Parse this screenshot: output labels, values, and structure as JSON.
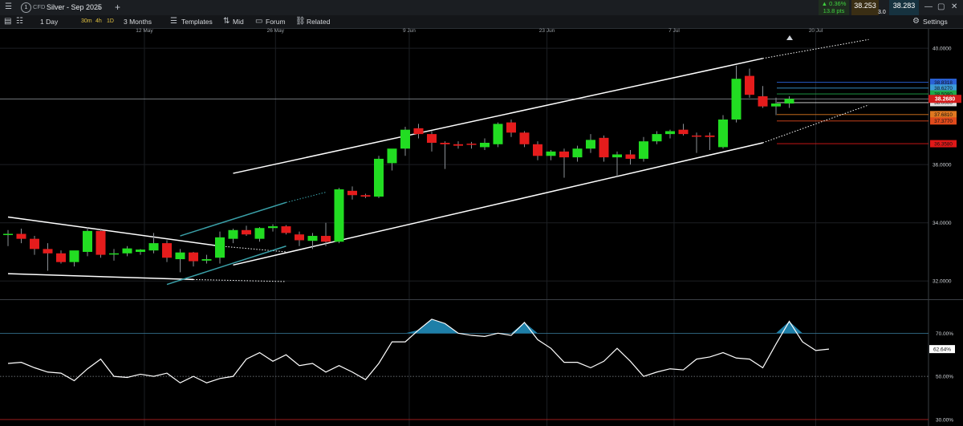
{
  "header": {
    "instrument_label": "CFD",
    "title": "Silver - Sep 2025",
    "add_label": "+",
    "change_pct": "▲ 0.36%",
    "change_pts": "13.8 pts",
    "bid": "38.253",
    "spread": "3.0",
    "ask": "38.283"
  },
  "toolbar": {
    "interval": "1 Day",
    "intervals": [
      "30m",
      "4h",
      "1D"
    ],
    "range": "3 Months",
    "templates": "Templates",
    "mid": "Mid",
    "forum": "Forum",
    "related": "Related",
    "settings": "Settings"
  },
  "colors": {
    "up": "#22dd22",
    "down": "#e51c1c",
    "rsi_line": "#ffffff",
    "rsi_fill": "#1e7fa8",
    "channel": "#ffffff",
    "teal_channel": "#3aa0a8"
  },
  "chart_data": [
    {
      "type": "candlestick",
      "title": "",
      "x_tick_labels": [
        "12 May",
        "26 May",
        "9 Jun",
        "23 Jun",
        "7 Jul",
        "20 Jul"
      ],
      "y_tick_labels": [
        "40.0000",
        "36.0000",
        "34.0000",
        "32.0000"
      ],
      "ylim": [
        31.4,
        40.5
      ],
      "grid": true,
      "current_price": "38.2680",
      "price_tags": [
        {
          "label": "38.8318",
          "value": 38.83,
          "color": "#2a62d6"
        },
        {
          "label": "38.6270",
          "value": 38.63,
          "color": "#3c9bd6"
        },
        {
          "label": "38.5080",
          "value": 38.43,
          "color": "#1fa84a"
        },
        {
          "label": "38.0000",
          "value": 38.13,
          "color": "#e0e0e0"
        },
        {
          "label": "37.6810",
          "value": 37.72,
          "color": "#e07820"
        },
        {
          "label": "37.3770",
          "value": 37.5,
          "color": "#e04a1c"
        },
        {
          "label": "36.3580",
          "value": 36.72,
          "color": "#e01818"
        }
      ],
      "candles": [
        {
          "o": 33.58,
          "h": 33.75,
          "l": 33.2,
          "c": 33.62
        },
        {
          "o": 33.62,
          "h": 33.8,
          "l": 33.3,
          "c": 33.45
        },
        {
          "o": 33.45,
          "h": 33.55,
          "l": 32.9,
          "c": 33.1
        },
        {
          "o": 33.1,
          "h": 33.3,
          "l": 32.35,
          "c": 32.95
        },
        {
          "o": 32.95,
          "h": 33.05,
          "l": 32.6,
          "c": 32.65
        },
        {
          "o": 32.65,
          "h": 33.0,
          "l": 32.5,
          "c": 33.05
        },
        {
          "o": 33.0,
          "h": 33.85,
          "l": 32.85,
          "c": 33.72
        },
        {
          "o": 33.72,
          "h": 33.8,
          "l": 32.8,
          "c": 32.9
        },
        {
          "o": 32.92,
          "h": 33.1,
          "l": 32.7,
          "c": 32.95
        },
        {
          "o": 32.95,
          "h": 33.2,
          "l": 32.85,
          "c": 33.12
        },
        {
          "o": 33.0,
          "h": 33.1,
          "l": 32.9,
          "c": 33.08
        },
        {
          "o": 33.05,
          "h": 33.65,
          "l": 32.95,
          "c": 33.3
        },
        {
          "o": 33.3,
          "h": 33.4,
          "l": 32.65,
          "c": 32.8
        },
        {
          "o": 32.75,
          "h": 33.1,
          "l": 32.3,
          "c": 32.98
        },
        {
          "o": 32.98,
          "h": 33.0,
          "l": 32.5,
          "c": 32.68
        },
        {
          "o": 32.7,
          "h": 32.9,
          "l": 32.6,
          "c": 32.75
        },
        {
          "o": 32.8,
          "h": 33.7,
          "l": 32.6,
          "c": 33.5
        },
        {
          "o": 33.45,
          "h": 33.8,
          "l": 33.3,
          "c": 33.75
        },
        {
          "o": 33.75,
          "h": 33.9,
          "l": 33.55,
          "c": 33.6
        },
        {
          "o": 33.45,
          "h": 33.85,
          "l": 33.35,
          "c": 33.82
        },
        {
          "o": 33.82,
          "h": 33.95,
          "l": 33.7,
          "c": 33.88
        },
        {
          "o": 33.88,
          "h": 33.92,
          "l": 33.6,
          "c": 33.65
        },
        {
          "o": 33.6,
          "h": 33.7,
          "l": 33.2,
          "c": 33.4
        },
        {
          "o": 33.38,
          "h": 33.65,
          "l": 33.1,
          "c": 33.55
        },
        {
          "o": 33.55,
          "h": 34.0,
          "l": 33.2,
          "c": 33.35
        },
        {
          "o": 33.35,
          "h": 35.2,
          "l": 33.3,
          "c": 35.15
        },
        {
          "o": 35.1,
          "h": 35.25,
          "l": 34.8,
          "c": 34.95
        },
        {
          "o": 34.95,
          "h": 35.0,
          "l": 34.85,
          "c": 34.9
        },
        {
          "o": 34.9,
          "h": 36.3,
          "l": 34.85,
          "c": 36.2
        },
        {
          "o": 36.05,
          "h": 36.5,
          "l": 35.8,
          "c": 36.55
        },
        {
          "o": 36.55,
          "h": 37.3,
          "l": 36.3,
          "c": 37.2
        },
        {
          "o": 37.25,
          "h": 37.4,
          "l": 36.9,
          "c": 37.05
        },
        {
          "o": 37.05,
          "h": 37.15,
          "l": 36.45,
          "c": 36.75
        },
        {
          "o": 36.75,
          "h": 36.8,
          "l": 35.85,
          "c": 36.7
        },
        {
          "o": 36.7,
          "h": 36.8,
          "l": 36.55,
          "c": 36.65
        },
        {
          "o": 36.72,
          "h": 36.78,
          "l": 36.55,
          "c": 36.68
        },
        {
          "o": 36.6,
          "h": 36.9,
          "l": 36.5,
          "c": 36.75
        },
        {
          "o": 36.7,
          "h": 37.45,
          "l": 36.6,
          "c": 37.4
        },
        {
          "o": 37.45,
          "h": 37.55,
          "l": 36.95,
          "c": 37.1
        },
        {
          "o": 37.1,
          "h": 37.15,
          "l": 36.6,
          "c": 36.7
        },
        {
          "o": 36.7,
          "h": 36.8,
          "l": 36.15,
          "c": 36.3
        },
        {
          "o": 36.3,
          "h": 36.5,
          "l": 36.15,
          "c": 36.45
        },
        {
          "o": 36.45,
          "h": 36.55,
          "l": 35.55,
          "c": 36.25
        },
        {
          "o": 36.25,
          "h": 36.65,
          "l": 36.1,
          "c": 36.55
        },
        {
          "o": 36.55,
          "h": 37.05,
          "l": 36.4,
          "c": 36.85
        },
        {
          "o": 36.92,
          "h": 37.0,
          "l": 36.1,
          "c": 36.25
        },
        {
          "o": 36.25,
          "h": 36.45,
          "l": 35.6,
          "c": 36.35
        },
        {
          "o": 36.35,
          "h": 36.5,
          "l": 36.0,
          "c": 36.2
        },
        {
          "o": 36.2,
          "h": 36.95,
          "l": 36.1,
          "c": 36.8
        },
        {
          "o": 36.8,
          "h": 37.15,
          "l": 36.7,
          "c": 37.05
        },
        {
          "o": 37.05,
          "h": 37.2,
          "l": 36.9,
          "c": 37.15
        },
        {
          "o": 37.2,
          "h": 37.4,
          "l": 37.0,
          "c": 37.05
        },
        {
          "o": 37.0,
          "h": 37.1,
          "l": 36.4,
          "c": 36.98
        },
        {
          "o": 37.0,
          "h": 37.1,
          "l": 36.5,
          "c": 36.95
        },
        {
          "o": 36.6,
          "h": 37.7,
          "l": 36.55,
          "c": 37.55
        },
        {
          "o": 37.55,
          "h": 39.4,
          "l": 37.45,
          "c": 38.95
        },
        {
          "o": 39.05,
          "h": 39.3,
          "l": 38.3,
          "c": 38.4
        },
        {
          "o": 38.35,
          "h": 38.7,
          "l": 37.95,
          "c": 38.0
        },
        {
          "o": 38.0,
          "h": 38.3,
          "l": 37.7,
          "c": 38.1
        },
        {
          "o": 38.1,
          "h": 38.35,
          "l": 37.95,
          "c": 38.26
        }
      ],
      "trendlines": [
        {
          "name": "upper-channel",
          "color": "#ffffff",
          "dotted": false,
          "points": [
            [
              17,
              35.7
            ],
            [
              57,
              39.65
            ]
          ]
        },
        {
          "name": "upper-channel-ext",
          "color": "#ffffff",
          "dotted": true,
          "points": [
            [
              57,
              39.65
            ],
            [
              65,
              40.3
            ]
          ]
        },
        {
          "name": "lower-channel",
          "color": "#ffffff",
          "dotted": false,
          "points": [
            [
              17,
              32.55
            ],
            [
              57,
              36.75
            ]
          ]
        },
        {
          "name": "lower-channel-ext",
          "color": "#ffffff",
          "dotted": true,
          "points": [
            [
              57,
              36.75
            ],
            [
              65,
              38.05
            ]
          ]
        },
        {
          "name": "falling-top",
          "color": "#ffffff",
          "dotted": false,
          "points": [
            [
              0,
              34.2
            ],
            [
              16,
              33.2
            ]
          ]
        },
        {
          "name": "falling-top-ext",
          "color": "#ffffff",
          "dotted": true,
          "points": [
            [
              16,
              33.2
            ],
            [
              21,
              33.0
            ]
          ]
        },
        {
          "name": "falling-bottom",
          "color": "#ffffff",
          "dotted": false,
          "points": [
            [
              0,
              32.25
            ],
            [
              14,
              32.05
            ]
          ]
        },
        {
          "name": "falling-bottom-ext",
          "color": "#ffffff",
          "dotted": true,
          "points": [
            [
              14,
              32.05
            ],
            [
              21,
              31.98
            ]
          ]
        },
        {
          "name": "teal-upper",
          "color": "#3aa0a8",
          "dotted": false,
          "points": [
            [
              13,
              33.55
            ],
            [
              21,
              34.7
            ]
          ]
        },
        {
          "name": "teal-upper-ext",
          "color": "#3aa0a8",
          "dotted": true,
          "points": [
            [
              21,
              34.7
            ],
            [
              24,
              35.05
            ]
          ]
        },
        {
          "name": "teal-lower",
          "color": "#3aa0a8",
          "dotted": false,
          "points": [
            [
              12,
              31.88
            ],
            [
              21,
              33.2
            ]
          ]
        }
      ]
    },
    {
      "type": "line",
      "title": "",
      "y_tick_labels": [
        "70.00%",
        "50.00%",
        "30.00%"
      ],
      "ylim": [
        27,
        85
      ],
      "levels": [
        70,
        50,
        30
      ],
      "current_value": "62.64%",
      "values": [
        56,
        56.5,
        54,
        52,
        51.5,
        48,
        53.5,
        58,
        50,
        49.5,
        51,
        50,
        51.5,
        47,
        50,
        47,
        49,
        50,
        58,
        61,
        57,
        60,
        55,
        56,
        52,
        55,
        52,
        48.5,
        56,
        66,
        66,
        71.5,
        76.5,
        74.5,
        70,
        69,
        68.5,
        70,
        69,
        75,
        67,
        63,
        56.5,
        56.5,
        54,
        57,
        63,
        57,
        50,
        52,
        53.5,
        53,
        58,
        59,
        61,
        58.5,
        58,
        54,
        65,
        75.5,
        66,
        62,
        62.64
      ]
    }
  ]
}
